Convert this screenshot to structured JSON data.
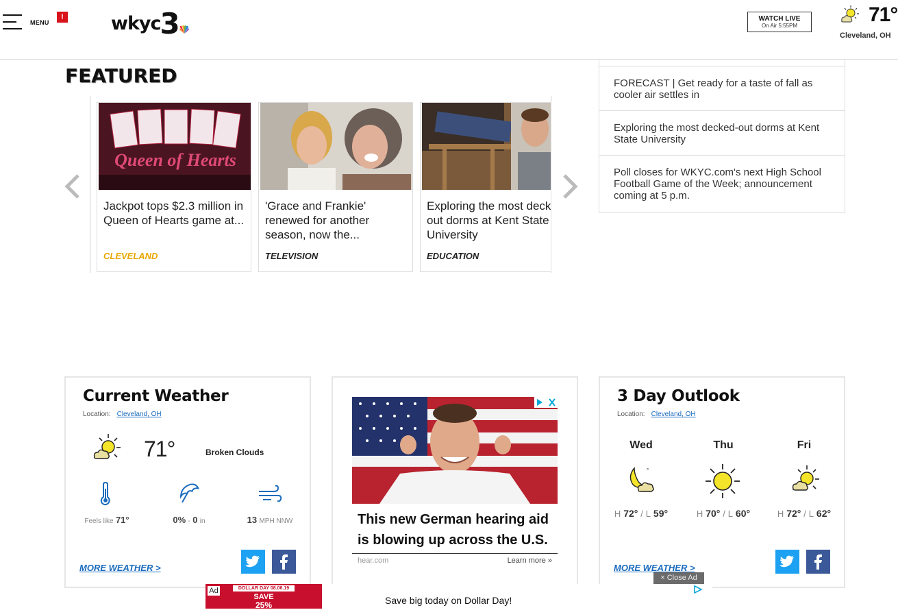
{
  "header": {
    "menu_label": "MENU",
    "alert_badge": "!",
    "logo_text": "wkyc",
    "logo_number": "3",
    "watch_live": {
      "label": "WATCH LIVE",
      "sublabel": "On Air 5:55PM"
    },
    "weather": {
      "temp": "71°",
      "location": "Cleveland, OH",
      "icon": "partly-sunny-icon"
    }
  },
  "featured": {
    "title": "FEATURED",
    "cards": [
      {
        "title": "Jackpot tops $2.3 million in Queen of Hearts game at...",
        "category": "CLEVELAND",
        "category_color": "#e8a700",
        "thumb_caption": "Queen of Hearts"
      },
      {
        "title": "'Grace and Frankie' renewed for another season, now the...",
        "category": "TELEVISION",
        "category_color": "#222222"
      },
      {
        "title": "Exploring the most decked-out dorms at Kent State University",
        "category": "EDUCATION",
        "category_color": "#222222"
      }
    ]
  },
  "headlines": [
    "FORECAST | Get ready for a taste of fall as cooler air settles in",
    "Exploring the most decked-out dorms at Kent State University",
    "Poll closes for WKYC.com's next High School Football Game of the Week; announcement coming at 5 p.m."
  ],
  "current_weather": {
    "title": "Current Weather",
    "location_label": "Location:",
    "location": "Cleveland, OH",
    "temp": "71°",
    "condition": "Broken Clouds",
    "feels_like_label": "Feels like",
    "feels_like": "71°",
    "precip_pct": "0%",
    "precip_sep": "-",
    "precip_amount": "0",
    "precip_unit": "in",
    "wind_speed": "13",
    "wind_unit": "MPH NNW",
    "more_link": "MORE WEATHER >"
  },
  "ad": {
    "headline": "This new German hearing aid is blowing up across the U.S.",
    "source": "hear.com",
    "learn_more": "Learn more »"
  },
  "outlook": {
    "title": "3 Day Outlook",
    "location_label": "Location:",
    "location": "Cleveland, OH",
    "days": [
      {
        "day": "Wed",
        "high": "72°",
        "low": "59°",
        "icon": "moon-cloud-icon"
      },
      {
        "day": "Thu",
        "high": "70°",
        "low": "60°",
        "icon": "sun-icon"
      },
      {
        "day": "Fri",
        "high": "72°",
        "low": "62°",
        "icon": "partly-sunny-icon"
      }
    ],
    "h_label": "H",
    "l_label": "L",
    "more_link": "MORE WEATHER >"
  },
  "bottom_ad": {
    "ad_label": "Ad",
    "banner_top": "DOLLAR DAY 08.06.19",
    "banner_save": "SAVE",
    "banner_pct": "25%",
    "text": "Save big today on Dollar Day!",
    "close_label": "× Close Ad"
  },
  "colors": {
    "accent_blue": "#1a6bbd",
    "twitter": "#1da1f2",
    "facebook": "#3b5998",
    "alert_red": "#d8131b",
    "sun_yellow": "#f5e52a"
  }
}
